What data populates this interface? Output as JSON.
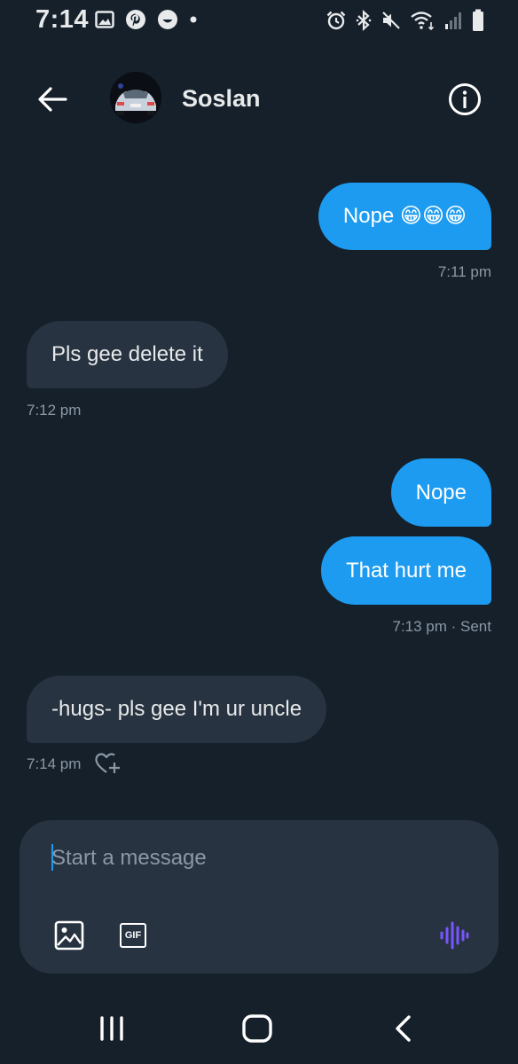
{
  "status_bar": {
    "time": "7:14",
    "left_icons": [
      "gallery-icon",
      "pinterest-icon",
      "smiley-icon",
      "dot-icon"
    ],
    "right_icons": [
      "alarm-icon",
      "bluetooth-icon",
      "mute-icon",
      "wifi-icon",
      "signal-icon",
      "battery-icon"
    ]
  },
  "header": {
    "contact_name": "Soslan"
  },
  "messages": [
    {
      "direction": "outgoing",
      "text": "Nope 😁😁😁",
      "time": "7:11 pm"
    },
    {
      "direction": "incoming",
      "text": "Pls gee delete it",
      "time": "7:12 pm"
    },
    {
      "direction": "outgoing",
      "text": "Nope"
    },
    {
      "direction": "outgoing",
      "text": "That hurt me",
      "time": "7:13 pm · Sent"
    },
    {
      "direction": "incoming",
      "text": "-hugs- pls gee I'm ur uncle",
      "time": "7:14 pm"
    }
  ],
  "composer": {
    "placeholder": "Start a message",
    "value": "",
    "gif_label": "GIF"
  },
  "colors": {
    "background": "#15202b",
    "outgoing_bubble": "#1d9bf0",
    "incoming_bubble": "#273340",
    "meta_text": "#8b98a5",
    "voice_icon": "#7856ff"
  }
}
